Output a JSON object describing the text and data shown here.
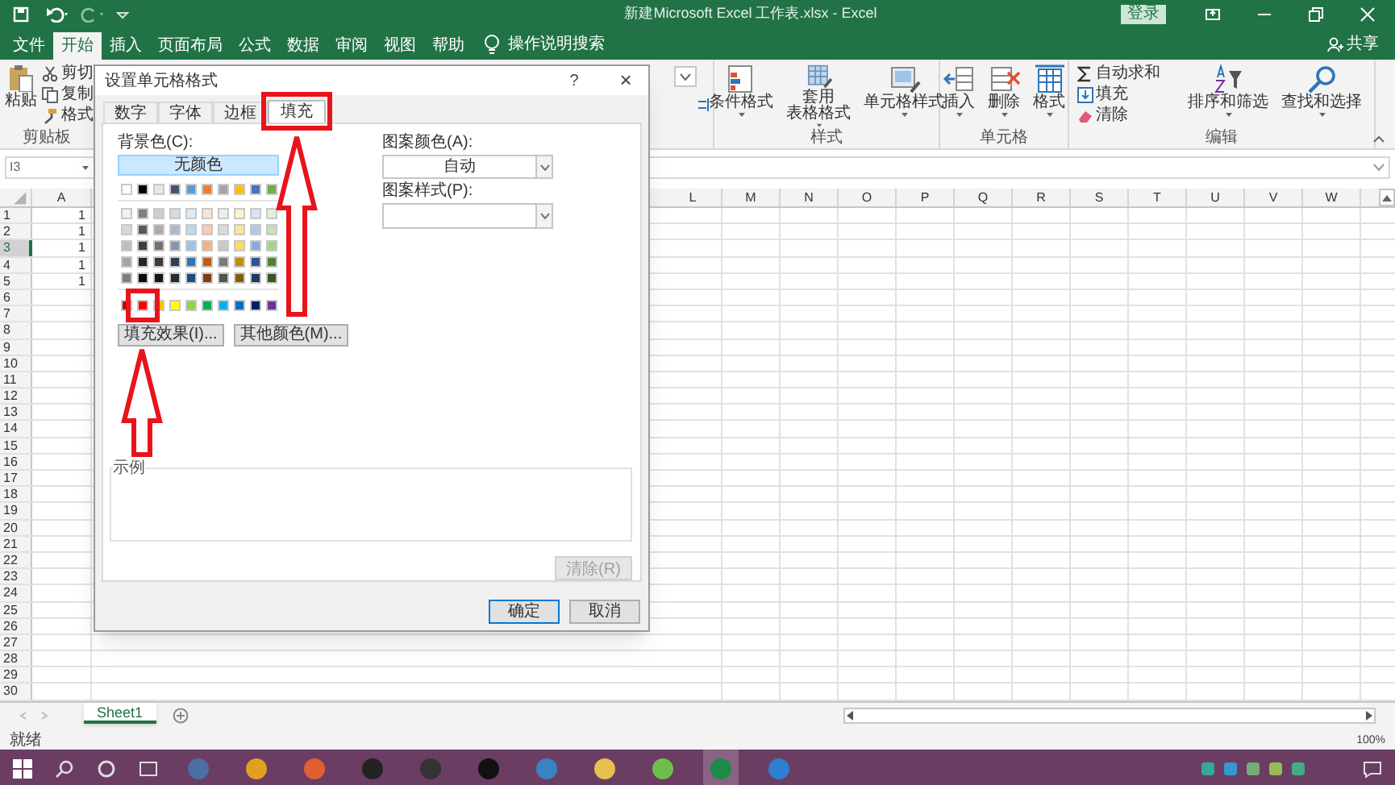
{
  "title_bar": {
    "title": "新建Microsoft Excel 工作表.xlsx - Excel",
    "sign_in": "登录"
  },
  "menu_tabs": [
    {
      "label": "文件",
      "selected": false
    },
    {
      "label": "开始",
      "selected": true
    },
    {
      "label": "插入",
      "selected": false
    },
    {
      "label": "页面布局",
      "selected": false
    },
    {
      "label": "公式",
      "selected": false
    },
    {
      "label": "数据",
      "selected": false
    },
    {
      "label": "审阅",
      "selected": false
    },
    {
      "label": "视图",
      "selected": false
    },
    {
      "label": "帮助",
      "selected": false
    }
  ],
  "tell_me": "操作说明搜索",
  "share": "共享",
  "ribbon": {
    "clipboard": {
      "paste": "粘贴",
      "cut": "剪切",
      "copy": "复制",
      "format_painter": "格式",
      "group": "剪贴板"
    },
    "styles": {
      "items": [
        {
          "lines": [
            "条件格式"
          ]
        },
        {
          "lines": [
            "套用",
            "表格格式"
          ]
        },
        {
          "lines": [
            "单元格样式"
          ]
        }
      ],
      "group": "样式"
    },
    "cells": {
      "items": [
        "插入",
        "删除",
        "格式"
      ],
      "group": "单元格"
    },
    "editing": {
      "autosum": "自动求和",
      "fill": "填充",
      "clear": "清除",
      "sort": "排序和筛选",
      "find": "查找和选择",
      "group": "编辑"
    }
  },
  "name_box": "I3",
  "columns": [
    {
      "label": "A"
    },
    {
      "label": "L"
    },
    {
      "label": "M"
    },
    {
      "label": "N"
    },
    {
      "label": "O"
    },
    {
      "label": "P"
    },
    {
      "label": "Q"
    },
    {
      "label": "R"
    },
    {
      "label": "S"
    },
    {
      "label": "T"
    },
    {
      "label": "U"
    },
    {
      "label": "V"
    },
    {
      "label": "W"
    }
  ],
  "rows": [
    {
      "number": "1",
      "a": "1",
      "selected": false
    },
    {
      "number": "2",
      "a": "1",
      "selected": false
    },
    {
      "number": "3",
      "a": "1",
      "selected": true
    },
    {
      "number": "4",
      "a": "1",
      "selected": false
    },
    {
      "number": "5",
      "a": "1",
      "selected": false
    },
    {
      "number": "6",
      "selected": false
    },
    {
      "number": "7",
      "selected": false
    },
    {
      "number": "8",
      "selected": false
    },
    {
      "number": "9",
      "selected": false
    },
    {
      "number": "10",
      "selected": false
    },
    {
      "number": "11",
      "selected": false
    },
    {
      "number": "12",
      "selected": false
    },
    {
      "number": "13",
      "selected": false
    },
    {
      "number": "14",
      "selected": false
    },
    {
      "number": "15",
      "selected": false
    },
    {
      "number": "16",
      "selected": false
    },
    {
      "number": "17",
      "selected": false
    },
    {
      "number": "18",
      "selected": false
    },
    {
      "number": "19",
      "selected": false
    },
    {
      "number": "20",
      "selected": false
    },
    {
      "number": "21",
      "selected": false
    },
    {
      "number": "22",
      "selected": false
    },
    {
      "number": "23",
      "selected": false
    },
    {
      "number": "24",
      "selected": false
    },
    {
      "number": "25",
      "selected": false
    },
    {
      "number": "26",
      "selected": false
    },
    {
      "number": "27",
      "selected": false
    },
    {
      "number": "28",
      "selected": false
    },
    {
      "number": "29",
      "selected": false
    },
    {
      "number": "30",
      "selected": false
    }
  ],
  "dialog": {
    "title": "设置单元格格式",
    "help": "?",
    "close": "×",
    "tabs": [
      {
        "label": "数字",
        "selected": false
      },
      {
        "label": "字体",
        "selected": false
      },
      {
        "label": "边框",
        "selected": false
      },
      {
        "label": "填充",
        "selected": true
      }
    ],
    "background_label": "背景色(C):",
    "no_color": "无颜色",
    "theme_colors": [
      {
        "color": "#ffffff"
      },
      {
        "color": "#000000"
      },
      {
        "color": "#e7e6e6"
      },
      {
        "color": "#44546a"
      },
      {
        "color": "#5b9bd5"
      },
      {
        "color": "#ed7d31"
      },
      {
        "color": "#a5a5a5"
      },
      {
        "color": "#ffc000"
      },
      {
        "color": "#4472c4"
      },
      {
        "color": "#70ad47"
      }
    ],
    "shades": [
      {
        "swatches": [
          {
            "color": "#f2f2f2"
          },
          {
            "color": "#7f7f7f"
          },
          {
            "color": "#d0cece"
          },
          {
            "color": "#d6dce4"
          },
          {
            "color": "#deebf6"
          },
          {
            "color": "#fbe5d5"
          },
          {
            "color": "#ededed"
          },
          {
            "color": "#fff2cc"
          },
          {
            "color": "#d9e2f3"
          },
          {
            "color": "#e2efd9"
          }
        ]
      },
      {
        "swatches": [
          {
            "color": "#d8d8d8"
          },
          {
            "color": "#595959"
          },
          {
            "color": "#aeabab"
          },
          {
            "color": "#adb9ca"
          },
          {
            "color": "#bdd7ee"
          },
          {
            "color": "#f7cbac"
          },
          {
            "color": "#dbdbdb"
          },
          {
            "color": "#fee599"
          },
          {
            "color": "#b4c6e7"
          },
          {
            "color": "#c5e0b3"
          }
        ]
      },
      {
        "swatches": [
          {
            "color": "#bfbfbf"
          },
          {
            "color": "#3f3f3f"
          },
          {
            "color": "#757070"
          },
          {
            "color": "#8496b0"
          },
          {
            "color": "#9dc3e6"
          },
          {
            "color": "#f4b183"
          },
          {
            "color": "#c9c9c9"
          },
          {
            "color": "#ffd965"
          },
          {
            "color": "#8eaadb"
          },
          {
            "color": "#a8d08d"
          }
        ]
      },
      {
        "swatches": [
          {
            "color": "#a5a5a5"
          },
          {
            "color": "#262626"
          },
          {
            "color": "#3a3838"
          },
          {
            "color": "#323f4f"
          },
          {
            "color": "#2e75b5"
          },
          {
            "color": "#c55a11"
          },
          {
            "color": "#7b7b7b"
          },
          {
            "color": "#bf9000"
          },
          {
            "color": "#2f5496"
          },
          {
            "color": "#538135"
          }
        ]
      },
      {
        "swatches": [
          {
            "color": "#7f7f7f"
          },
          {
            "color": "#0c0c0c"
          },
          {
            "color": "#171616"
          },
          {
            "color": "#222a35"
          },
          {
            "color": "#1e4e79"
          },
          {
            "color": "#833c0b"
          },
          {
            "color": "#525252"
          },
          {
            "color": "#7f6000"
          },
          {
            "color": "#1f3864"
          },
          {
            "color": "#375623"
          }
        ]
      }
    ],
    "standard_colors": [
      {
        "color": "#c00000"
      },
      {
        "color": "#ff0000"
      },
      {
        "color": "#ffc000"
      },
      {
        "color": "#ffff00"
      },
      {
        "color": "#92d050"
      },
      {
        "color": "#00b050"
      },
      {
        "color": "#00b0f0"
      },
      {
        "color": "#0070c0"
      },
      {
        "color": "#002060"
      },
      {
        "color": "#7030a0"
      }
    ],
    "fill_effects": "填充效果(I)...",
    "more_colors": "其他颜色(M)...",
    "pattern_color_label": "图案颜色(A):",
    "pattern_color": "自动",
    "pattern_style_label": "图案样式(P):",
    "sample_label": "示例",
    "clear": {
      "label": "清除(R)",
      "disabled": true
    },
    "ok": "确定",
    "cancel": "取消"
  },
  "sheet_tabs": [
    {
      "label": "Sheet1",
      "selected": true
    }
  ],
  "status": {
    "ready": "就绪",
    "zoom": "100%"
  }
}
